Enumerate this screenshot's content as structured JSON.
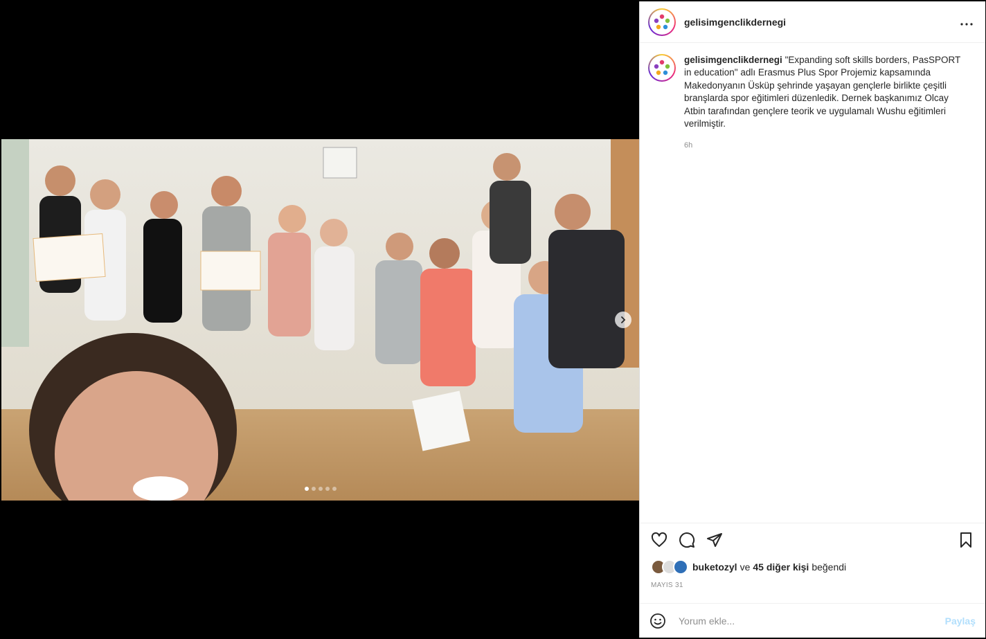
{
  "post": {
    "username": "gelisimgenclikdernegi",
    "caption": "\"Expanding soft skills borders, PasSPORT in education\" adlı Erasmus Plus Spor Projemiz kapsamında Makedonyanın Üsküp şehrinde yaşayan gençlerle birlikte çeşitli branşlarda spor eğitimleri düzenledik. Dernek başkanımız Olcay Atbin tarafından gençlere teorik ve uygulamalı Wushu eğitimleri verilmiştir.",
    "time_ago": "6h",
    "more_label": "···"
  },
  "media": {
    "carousel_count": 5,
    "active_index": 0,
    "next_icon": "chevron-right-icon"
  },
  "likes": {
    "first_user": "buketozyl",
    "connector": "ve",
    "others": "45 diğer kişi",
    "suffix": "beğendi"
  },
  "date": "MAYIS 31",
  "comment": {
    "placeholder": "Yorum ekle...",
    "post_label": "Paylaş"
  },
  "icons": [
    "heart-icon",
    "comment-icon",
    "share-icon",
    "bookmark-icon",
    "emoji-icon",
    "more-icon"
  ],
  "colors": {
    "accent_disabled": "#b2dffc",
    "text": "#262626",
    "muted": "#8e8e8e"
  }
}
